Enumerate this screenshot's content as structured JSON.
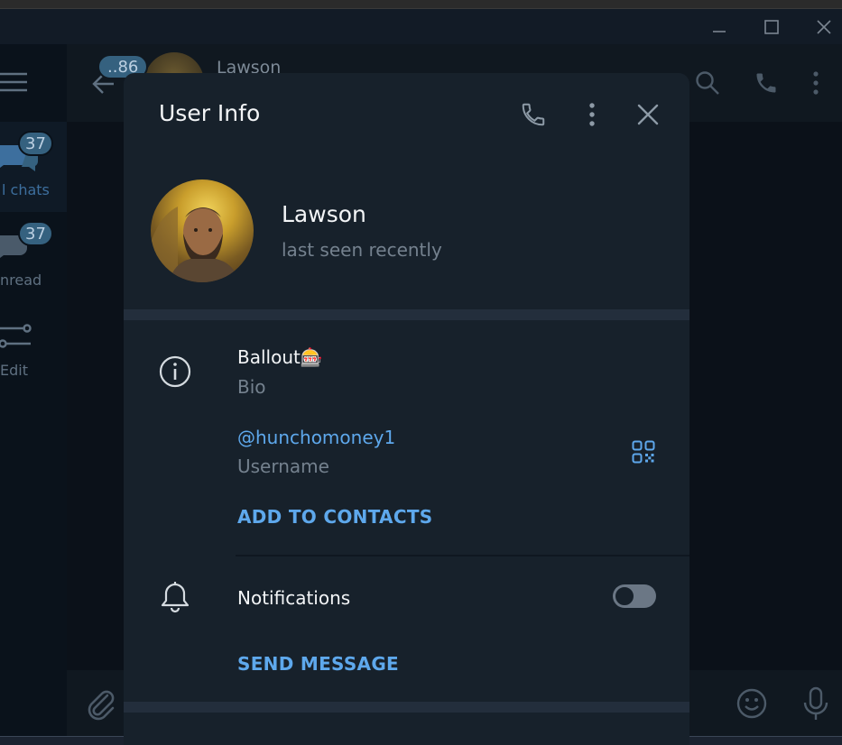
{
  "background": {
    "folders": [
      {
        "label": "l chats",
        "badge": "37",
        "active": true
      },
      {
        "label": "nread",
        "badge": "37",
        "active": false
      },
      {
        "label": "Edit",
        "badge": null,
        "active": false
      }
    ],
    "back_badge": "..86",
    "chat_name": "Lawson"
  },
  "modal": {
    "title": "User Info",
    "profile": {
      "name": "Lawson",
      "status": "last seen recently"
    },
    "bio": {
      "value": "Ballout🎰",
      "label": "Bio"
    },
    "username": {
      "value": "@hunchomoney1",
      "label": "Username"
    },
    "add_contact": "ADD TO CONTACTS",
    "notifications": {
      "label": "Notifications",
      "enabled": false
    },
    "send_message": "SEND MESSAGE"
  },
  "colors": {
    "accent": "#5ea8ec",
    "modal_bg": "#17212b",
    "separator": "#232e3c",
    "muted_text": "#74818e"
  },
  "icons": {
    "call": "phone-icon",
    "more": "more-vertical-icon",
    "close": "close-icon",
    "info": "info-icon",
    "qr": "qr-code-icon",
    "bell": "bell-icon"
  }
}
